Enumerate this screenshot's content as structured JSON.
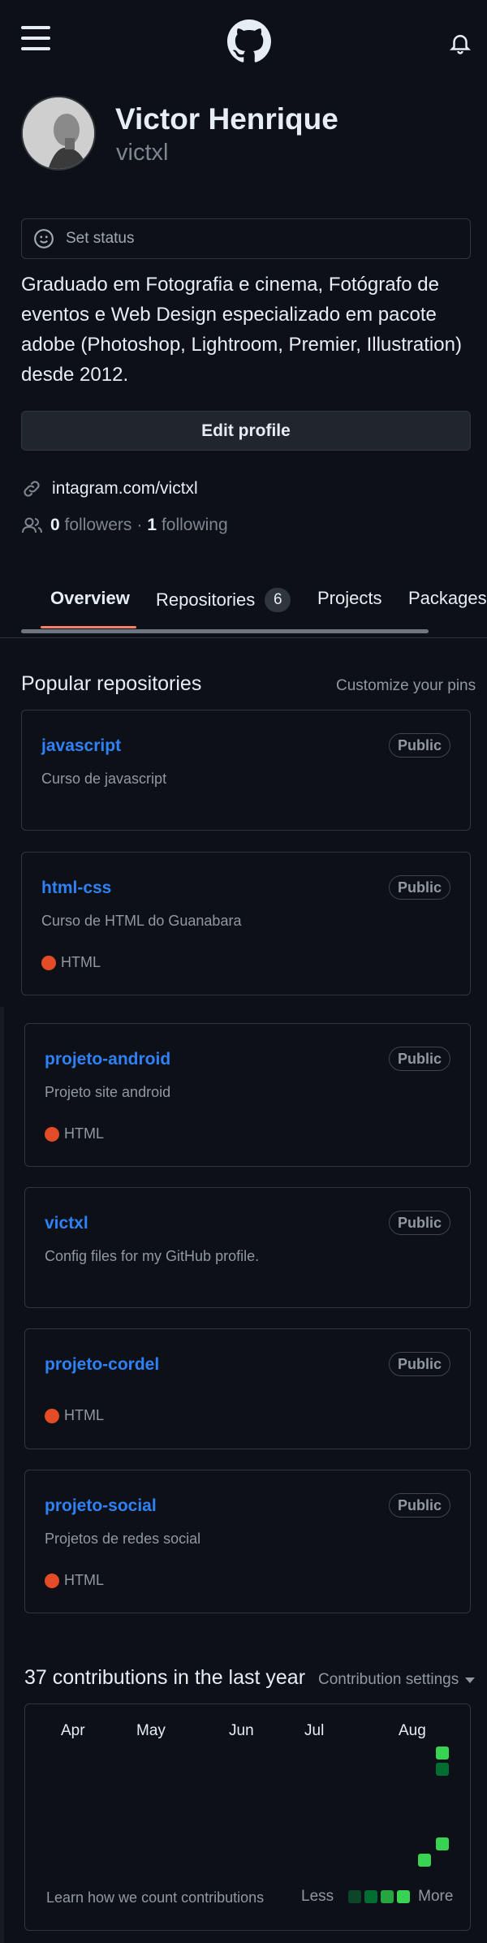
{
  "header": {
    "menu_icon": "hamburger-menu-icon",
    "logo_icon": "github-logo-icon",
    "notification_icon": "bell-icon"
  },
  "profile": {
    "full_name": "Victor Henrique",
    "username": "victxl",
    "set_status": "Set status",
    "bio": "Graduado em Fotografia e cinema, Fotógrafo de eventos e Web Design especializado em pacote adobe (Photoshop, Lightroom, Premier, Illustration) desde 2012.",
    "edit_profile": "Edit profile",
    "website": "intagram.com/victxl",
    "followers_count": "0",
    "followers_label": "followers",
    "following_count": "1",
    "following_label": "following"
  },
  "tabs": [
    {
      "label": "Overview",
      "active": true
    },
    {
      "label": "Repositories",
      "count": "6"
    },
    {
      "label": "Projects"
    },
    {
      "label": "Packages"
    }
  ],
  "popular": {
    "title": "Popular repositories",
    "customize": "Customize your pins",
    "repos": [
      {
        "name": "javascript",
        "visibility": "Public",
        "description": "Curso de javascript",
        "language": ""
      },
      {
        "name": "html-css",
        "visibility": "Public",
        "description": "Curso de HTML do Guanabara",
        "language": "HTML"
      },
      {
        "name": "projeto-android",
        "visibility": "Public",
        "description": "Projeto site android",
        "language": "HTML"
      },
      {
        "name": "victxl",
        "visibility": "Public",
        "description": "Config files for my GitHub profile.",
        "language": ""
      },
      {
        "name": "projeto-cordel",
        "visibility": "Public",
        "description": "",
        "language": "HTML"
      },
      {
        "name": "projeto-social",
        "visibility": "Public",
        "description": "Projetos de redes social",
        "language": "HTML"
      }
    ],
    "html_color": "#e34c26"
  },
  "contributions": {
    "title": "37 contributions in the last year",
    "settings": "Contribution settings",
    "months": [
      "Apr",
      "May",
      "Jun",
      "Jul",
      "Aug"
    ],
    "learn": "Learn how we count contributions",
    "less": "Less",
    "more": "More",
    "colors": [
      "#0e4429",
      "#006d32",
      "#26a641",
      "#39d353"
    ]
  }
}
